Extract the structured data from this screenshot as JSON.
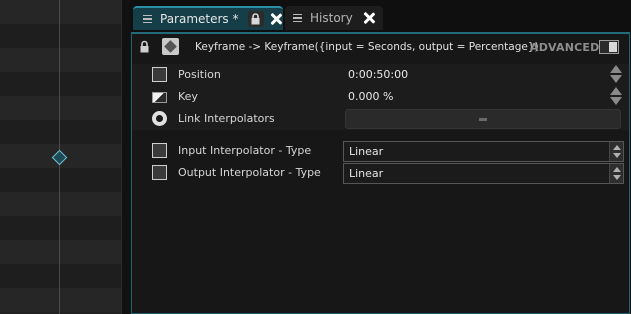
{
  "tabs": [
    {
      "label": "Parameters *",
      "active": true
    },
    {
      "label": "History",
      "active": false
    }
  ],
  "header": {
    "title": "Keyframe -> Keyframe({input = Seconds, output = Percentage})",
    "advanced_label": "ADVANCED"
  },
  "params": [
    {
      "label": "Position",
      "value": "0:00:50:00",
      "icon": "param-icon"
    },
    {
      "label": "Key",
      "value": "0.000 %",
      "icon": "key-gradient-icon"
    },
    {
      "label": "Link Interpolators",
      "value": "",
      "icon": "radio-icon"
    }
  ],
  "interpolators": [
    {
      "label": "Input Interpolator - Type",
      "value": "Linear"
    },
    {
      "label": "Output Interpolator - Type",
      "value": "Linear"
    }
  ],
  "colors": {
    "accent": "#2a8fa6",
    "tab_active_bg": "#163e48",
    "keyframe_marker": "#6fc3d6"
  }
}
